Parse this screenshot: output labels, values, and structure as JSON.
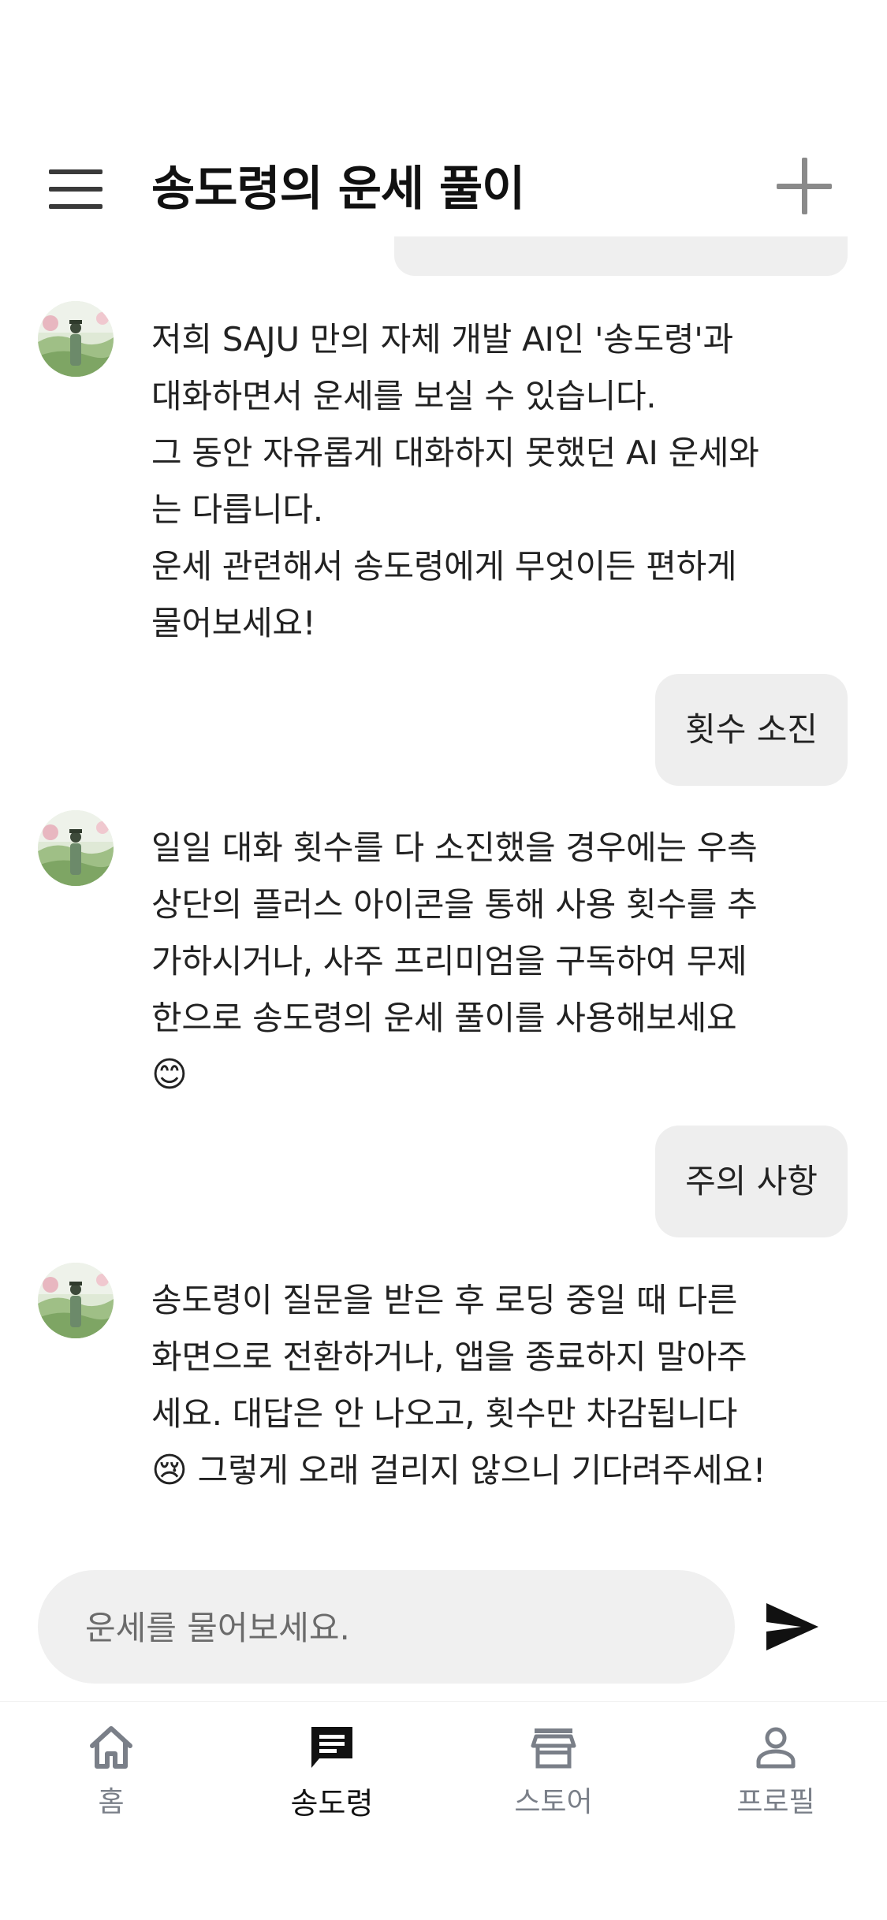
{
  "header": {
    "title": "송도령의 운세 풀이",
    "menu_icon": "hamburger-menu-icon",
    "add_icon": "plus-icon"
  },
  "messages": [
    {
      "role": "bot",
      "text": "저희 SAJU 만의 자체 개발 AI인 '송도령'과\n대화하면서 운세를 보실 수 있습니다.\n그 동안 자유롭게 대화하지 못했던 AI 운세와\n는 다릅니다.\n운세 관련해서 송도령에게 무엇이든 편하게\n물어보세요!"
    },
    {
      "role": "user",
      "text": "횟수 소진"
    },
    {
      "role": "bot",
      "text": "일일 대화 횟수를 다 소진했을 경우에는 우측\n상단의 플러스 아이콘을 통해 사용 횟수를 추\n가하시거나, 사주 프리미엄을 구독하여 무제\n한으로 송도령의 운세 풀이를 사용해보세요",
      "emoji": "😊"
    },
    {
      "role": "user",
      "text": "주의 사항"
    },
    {
      "role": "bot",
      "text": "송도령이 질문을 받은 후 로딩 중일 때 다른\n화면으로 전환하거나, 앱을 종료하지 말아주\n세요. 대답은 안 나오고, 횟수만 차감됩니다",
      "emoji": "😢",
      "tail": "그렇게 오래 걸리지 않으니 기다려주세요!"
    }
  ],
  "input": {
    "placeholder": "운세를 물어보세요.",
    "value": "",
    "send_icon": "send-icon"
  },
  "nav": {
    "items": [
      {
        "label": "홈",
        "icon": "home-icon",
        "active": false
      },
      {
        "label": "송도령",
        "icon": "chat-icon",
        "active": true
      },
      {
        "label": "스토어",
        "icon": "store-icon",
        "active": false
      },
      {
        "label": "프로필",
        "icon": "profile-icon",
        "active": false
      }
    ],
    "active_color": "#111111",
    "inactive_color": "#7a7f88"
  }
}
